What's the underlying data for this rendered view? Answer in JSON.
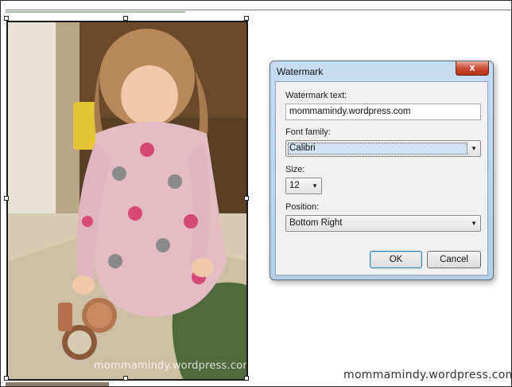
{
  "photo": {
    "watermark_text": "mommamindy.wordpress.com"
  },
  "page": {
    "watermark_text": "mommamindy.wordpress.com"
  },
  "dialog": {
    "title": "Watermark",
    "close_glyph": "x",
    "fields": {
      "watermark_text_label": "Watermark text:",
      "watermark_text_value": "mommamindy.wordpress.com",
      "font_family_label": "Font family:",
      "font_family_value": "Calibri",
      "size_label": "Size:",
      "size_value": "12",
      "position_label": "Position:",
      "position_value": "Bottom Right"
    },
    "buttons": {
      "ok": "OK",
      "cancel": "Cancel"
    }
  },
  "icons": {
    "close": "close-icon",
    "dropdown": "chevron-down-icon"
  },
  "colors": {
    "titlebar": "#c7dcf1",
    "close_button": "#c9462f",
    "dialog_body": "#f0f0f0"
  }
}
